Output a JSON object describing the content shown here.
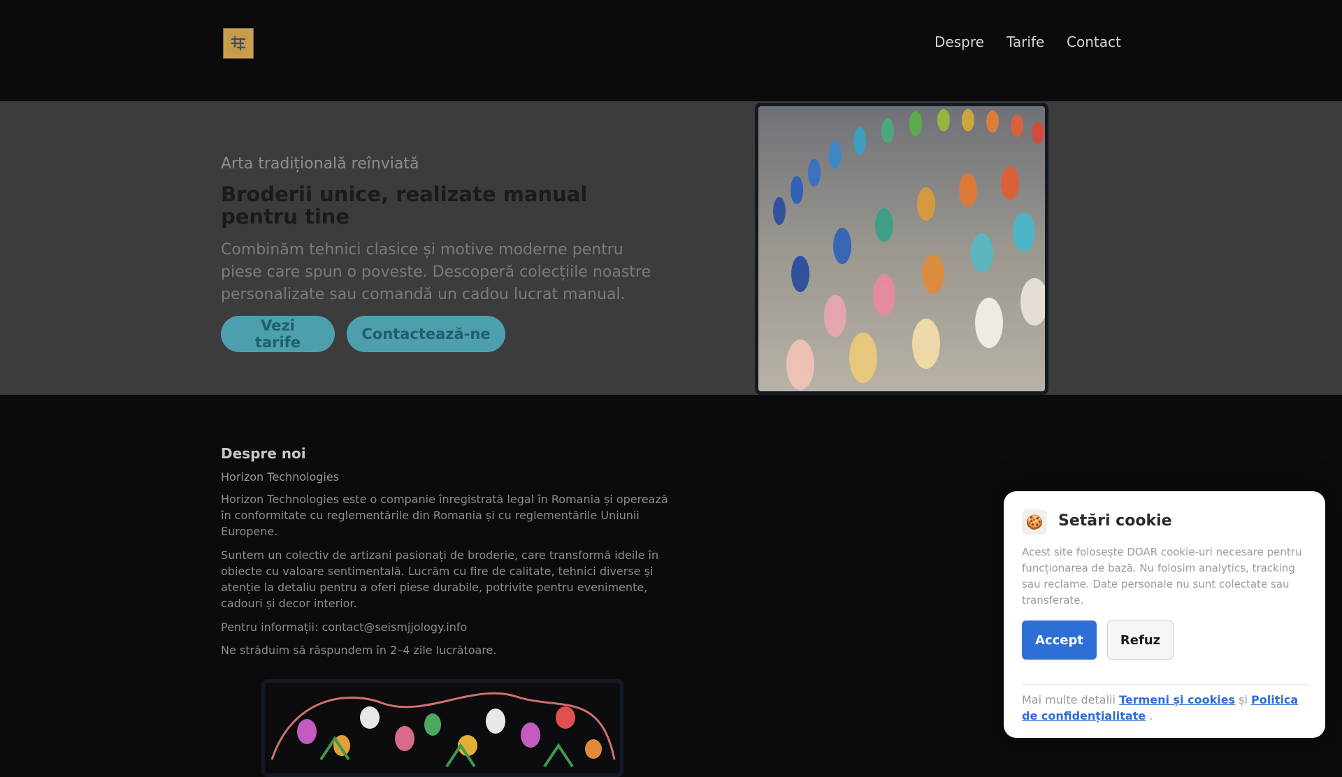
{
  "header": {
    "nav": [
      "Despre",
      "Tarife",
      "Contact"
    ]
  },
  "hero": {
    "eyebrow": "Arta tradițională reînviată",
    "title": "Broderii unice, realizate manual pentru tine",
    "description": "Combinăm tehnici clasice și motive moderne pentru piese care spun o poveste. Descoperă colecțiile noastre personalizate sau comandă un cadou lucrat manual.",
    "buttons": [
      "Vezi tarife",
      "Contactează-ne"
    ]
  },
  "about": {
    "title": "Despre noi",
    "company": "Horizon Technologies",
    "paragraphs": [
      "Horizon Technologies este o companie înregistrată legal în Romania și operează în conformitate cu reglementările din Romania și cu reglementările Uniunii Europene.",
      "Suntem un colectiv de artizani pasionați de broderie, care transformă ideile în obiecte cu valoare sentimentală. Lucrăm cu fire de calitate, tehnici diverse și atenție la detaliu pentru a oferi piese durabile, potrivite pentru evenimente, cadouri și decor interior.",
      "Pentru informații: contact@seismjjology.info",
      "Ne străduim să răspundem în 2–4 zile lucrătoare."
    ]
  },
  "cookie": {
    "icon": "cookie-icon",
    "title": "Setări cookie",
    "text": "Acest site folosește DOAR cookie-uri necesare pentru funcționarea de bază. Nu folosim analytics, tracking sau reclame. Date personale nu sunt colectate sau transferate.",
    "accept": "Accept",
    "refuse": "Refuz",
    "footer_prefix": "Mai multe detalii",
    "link_terms": "Termeni și cookies",
    "conjunction": "și",
    "link_privacy": "Politica de confidențialitate",
    "footer_suffix": "."
  },
  "colors": {
    "accent": "#2e6fd5",
    "hero_button": "#4e9fae",
    "background": "#0b0b0c"
  }
}
